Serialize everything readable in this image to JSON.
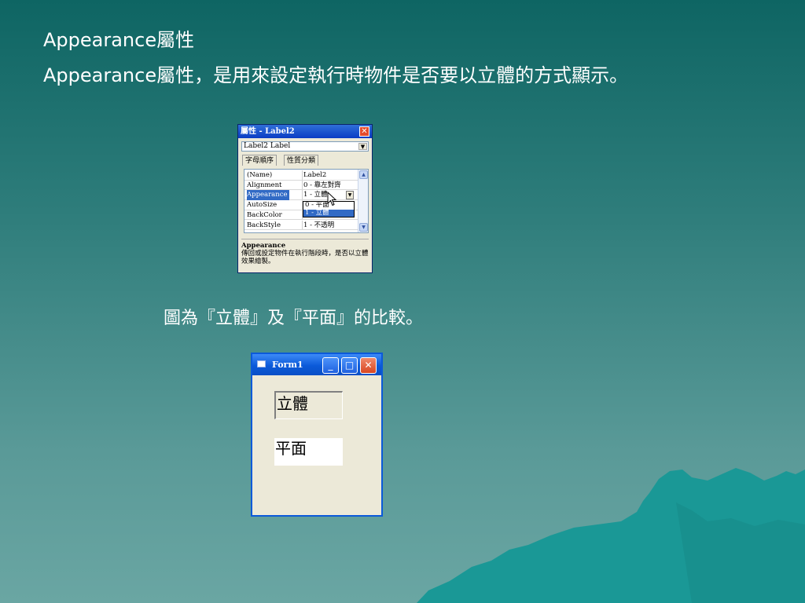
{
  "slide": {
    "title": "Appearance屬性",
    "body": "Appearance屬性，是用來設定執行時物件是否要以立體的方式顯示。",
    "caption": "圖為『立體』及『平面』的比較。"
  },
  "properties_window": {
    "title": "屬性 - Label2",
    "close_glyph": "✕",
    "object_selector": "Label2 Label",
    "tabs": [
      "字母順序",
      "性質分類"
    ],
    "rows": [
      {
        "name": "(Name)",
        "value": "Label2"
      },
      {
        "name": "Alignment",
        "value": "0 - 靠左對齊"
      },
      {
        "name": "Appearance",
        "value": "1 - 立體"
      },
      {
        "name": "AutoSize",
        "value": ""
      },
      {
        "name": "BackColor",
        "value": ""
      },
      {
        "name": "BackStyle",
        "value": "1 - 不透明"
      }
    ],
    "dropdown_options": [
      "0 - 平面",
      "1 - 立體"
    ],
    "description_title": "Appearance",
    "description_text": "傳回或設定物件在執行階段時，是否以立體效果繪製。"
  },
  "form1": {
    "title": "Form1",
    "minimize_glyph": "_",
    "maximize_glyph": "□",
    "close_glyph": "✕",
    "label_3d": "立體",
    "label_flat": "平面"
  },
  "colors": {
    "background_top": "#0e6563",
    "background_bottom": "#6aa6a3",
    "mountain": "#1a9896",
    "xp_blue": "#0b5ad9",
    "selection": "#316ac5"
  }
}
